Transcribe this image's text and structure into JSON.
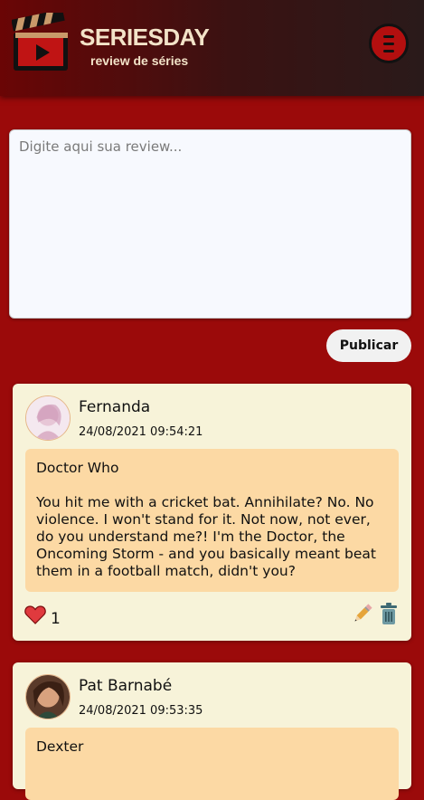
{
  "header": {
    "title": "SERIESDAY",
    "subtitle": "review de séries"
  },
  "composer": {
    "placeholder": "Digite aqui sua review...",
    "publish_label": "Publicar"
  },
  "reviews": [
    {
      "author": "Fernanda",
      "datetime": "24/08/2021 09:54:21",
      "series": "Doctor Who",
      "text": "You hit me with a cricket bat. Annihilate? No. No violence. I won't stand for it. Not now, not ever, do you understand me?! I'm the Doctor, the Oncoming Storm - and you basically meant beat them in a football match, didn't you?",
      "likes": "1"
    },
    {
      "author": "Pat Barnabé",
      "datetime": "24/08/2021 09:53:35",
      "series": "Dexter"
    }
  ],
  "colors": {
    "background": "#9b0a0a",
    "card": "#f7f3d9",
    "content": "#fcd9a4",
    "accent": "#b30f0f"
  },
  "icons": [
    "clapperboard-logo-icon",
    "hamburger-menu-icon",
    "heart-icon",
    "pencil-edit-icon",
    "trash-icon"
  ]
}
